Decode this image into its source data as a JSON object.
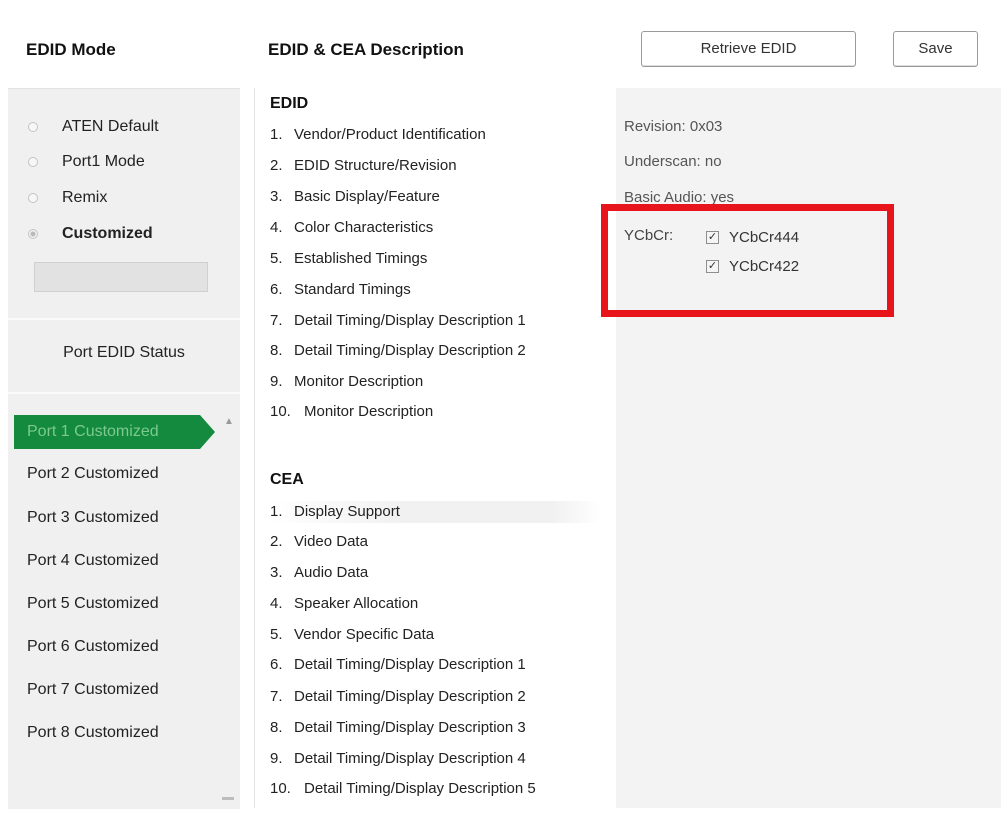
{
  "header": {
    "edid_mode_title": "EDID Mode",
    "description_title": "EDID & CEA Description",
    "retrieve_label": "Retrieve EDID",
    "save_label": "Save"
  },
  "modes": [
    {
      "label": "ATEN Default",
      "checked": false
    },
    {
      "label": "Port1 Mode",
      "checked": false
    },
    {
      "label": "Remix",
      "checked": false
    },
    {
      "label": "Customized",
      "checked": true
    }
  ],
  "port_status": {
    "title": "Port EDID Status",
    "ports": [
      "Port 1  Customized",
      "Port 2  Customized",
      "Port 3  Customized",
      "Port 4  Customized",
      "Port 5  Customized",
      "Port 6  Customized",
      "Port 7  Customized",
      "Port 8  Customized"
    ]
  },
  "edid": {
    "title": "EDID",
    "items": [
      {
        "num": "1.",
        "label": "Vendor/Product Identification"
      },
      {
        "num": "2.",
        "label": "EDID Structure/Revision"
      },
      {
        "num": "3.",
        "label": "Basic Display/Feature"
      },
      {
        "num": "4.",
        "label": "Color Characteristics"
      },
      {
        "num": "5.",
        "label": "Established Timings"
      },
      {
        "num": "6.",
        "label": "Standard Timings"
      },
      {
        "num": "7.",
        "label": "Detail Timing/Display Description 1"
      },
      {
        "num": "8.",
        "label": "Detail Timing/Display Description 2"
      },
      {
        "num": "9.",
        "label": "Monitor Description"
      },
      {
        "num": "10.",
        "label": "Monitor Description"
      }
    ]
  },
  "cea": {
    "title": "CEA",
    "items": [
      {
        "num": "1.",
        "label": "Display Support"
      },
      {
        "num": "2.",
        "label": "Video Data"
      },
      {
        "num": "3.",
        "label": "Audio Data"
      },
      {
        "num": "4.",
        "label": "Speaker Allocation"
      },
      {
        "num": "5.",
        "label": "Vendor Specific Data"
      },
      {
        "num": "6.",
        "label": "Detail Timing/Display Description 1"
      },
      {
        "num": "7.",
        "label": "Detail Timing/Display Description 2"
      },
      {
        "num": "8.",
        "label": "Detail Timing/Display Description 3"
      },
      {
        "num": "9.",
        "label": "Detail Timing/Display Description 4"
      },
      {
        "num": "10.",
        "label": "Detail Timing/Display Description 5"
      }
    ]
  },
  "details": {
    "revision": "Revision: 0x03",
    "underscan": "Underscan: no",
    "basic_audio": "Basic Audio: yes",
    "ycbcr_label": "YCbCr:",
    "ycbcr444": {
      "label": "YCbCr444",
      "checked": true
    },
    "ycbcr422": {
      "label": "YCbCr422",
      "checked": true
    }
  },
  "colors": {
    "active_port_bg": "#138a3e",
    "highlight_border": "#e8141c"
  }
}
